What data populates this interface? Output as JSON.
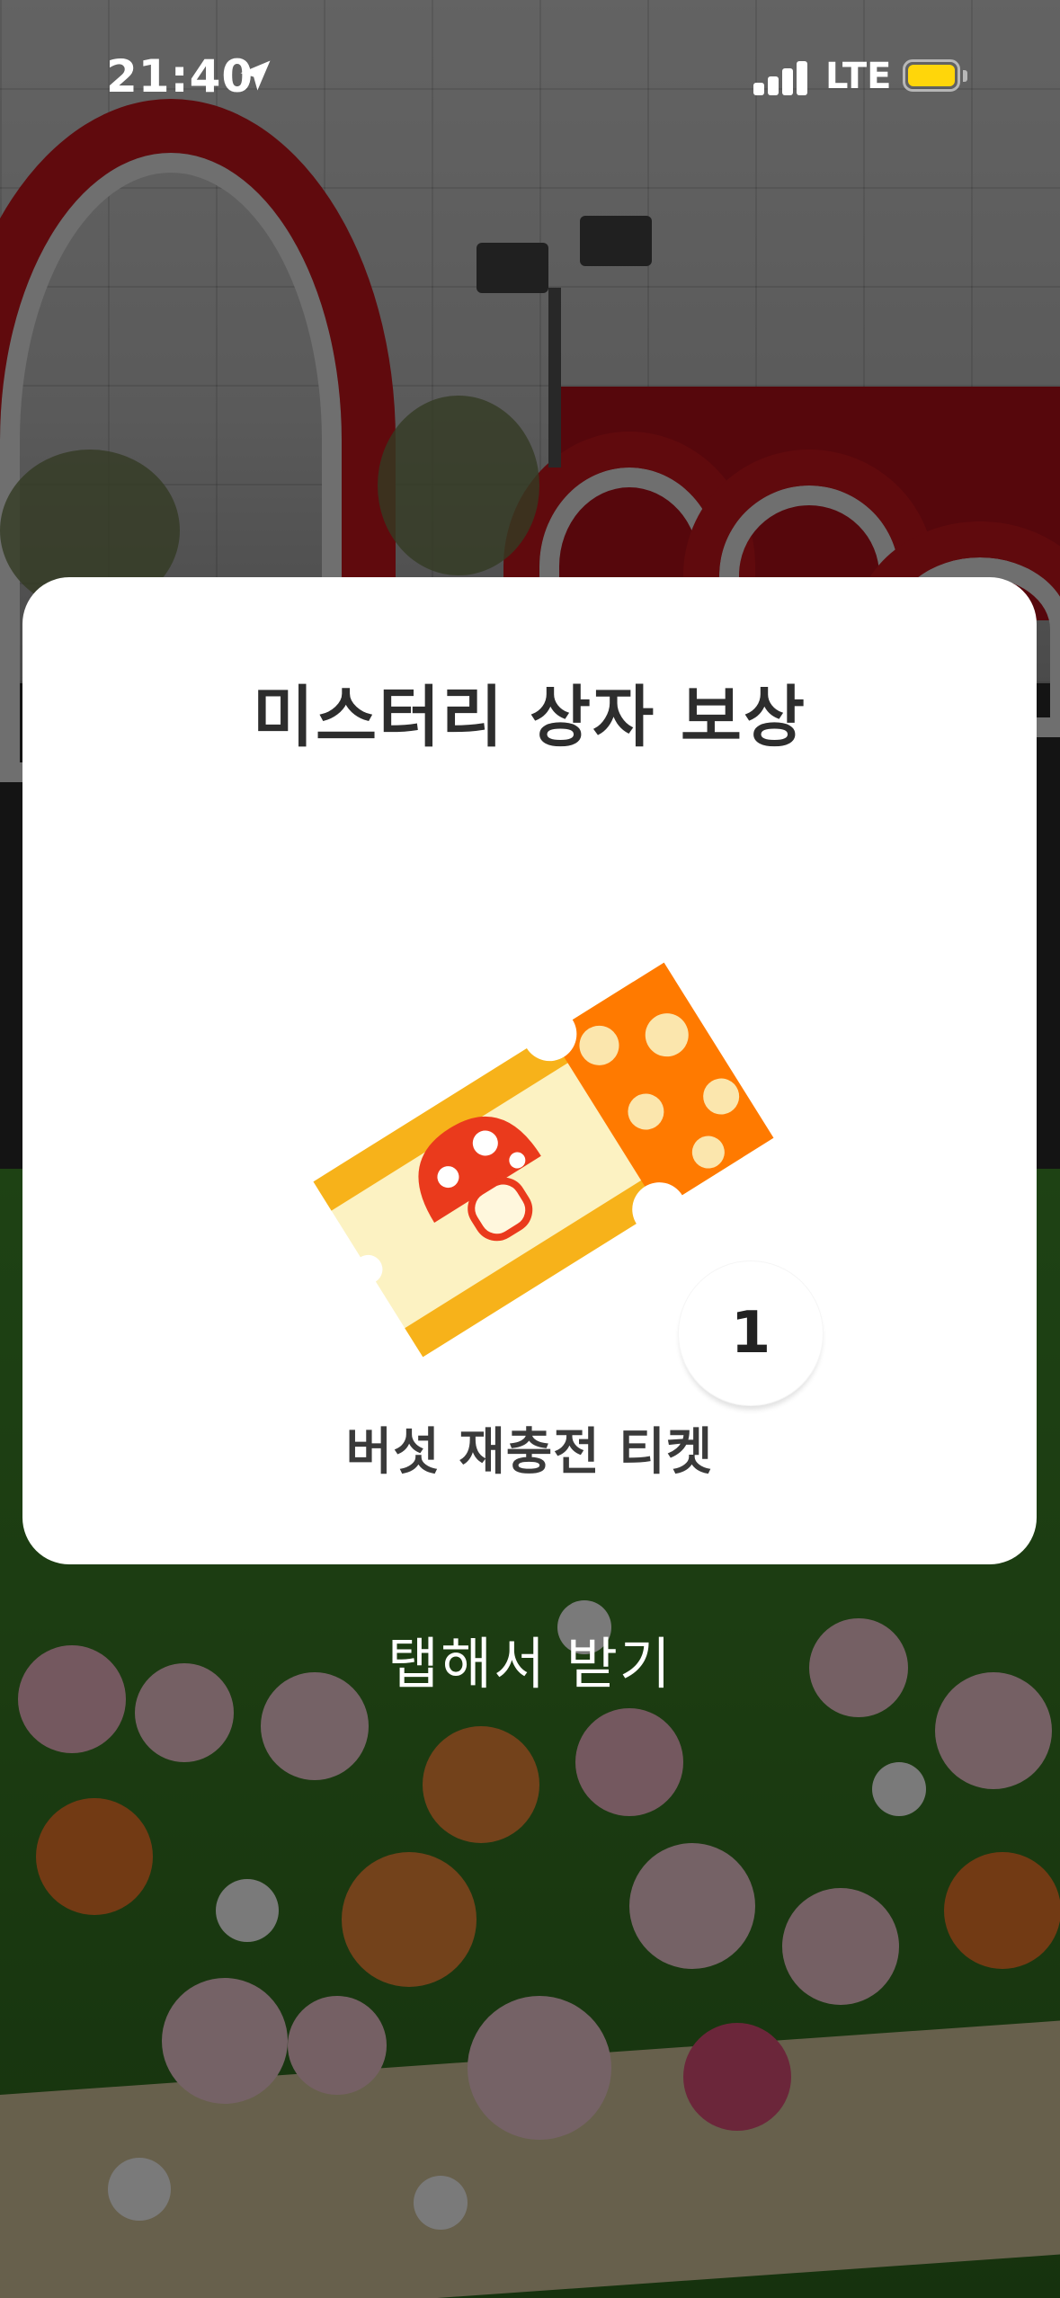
{
  "status_bar": {
    "time": "21:40",
    "network": "LTE",
    "battery_color": "#ffd60a",
    "location_icon": "location-arrow-icon"
  },
  "reward_popup": {
    "title": "미스터리 상자 보상",
    "item": {
      "name": "버섯 재충전 티켓",
      "quantity": "1",
      "icon": "mushroom-ticket-icon"
    }
  },
  "tap_hint": "탭해서 받기"
}
